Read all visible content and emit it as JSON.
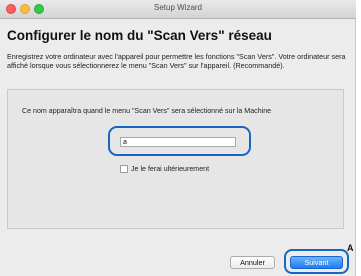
{
  "window": {
    "title": "Setup Wizard"
  },
  "page": {
    "heading": "Configurer le nom du \"Scan Vers\" réseau",
    "description": "Enregistrez votre ordinateur avec l'appareil pour permettre les fonctions \"Scan Vers\". Votre ordinateur sera affiché lorsque vous sélectionnerez le menu \"Scan Vers\" sur l'appareil. (Recommandé)."
  },
  "form": {
    "label": "Ce nom apparaîtra quand le menu \"Scan Vers\" sera sélectionné sur la Machine",
    "name_value": "a",
    "checkbox_label": "Je le ferai ultérieurement",
    "checkbox_checked": false
  },
  "buttons": {
    "cancel": "Annuler",
    "next": "Suivant"
  },
  "callout": {
    "marker": "A"
  },
  "colors": {
    "highlight": "#1766c2",
    "primary_button": "#1f7df2"
  }
}
